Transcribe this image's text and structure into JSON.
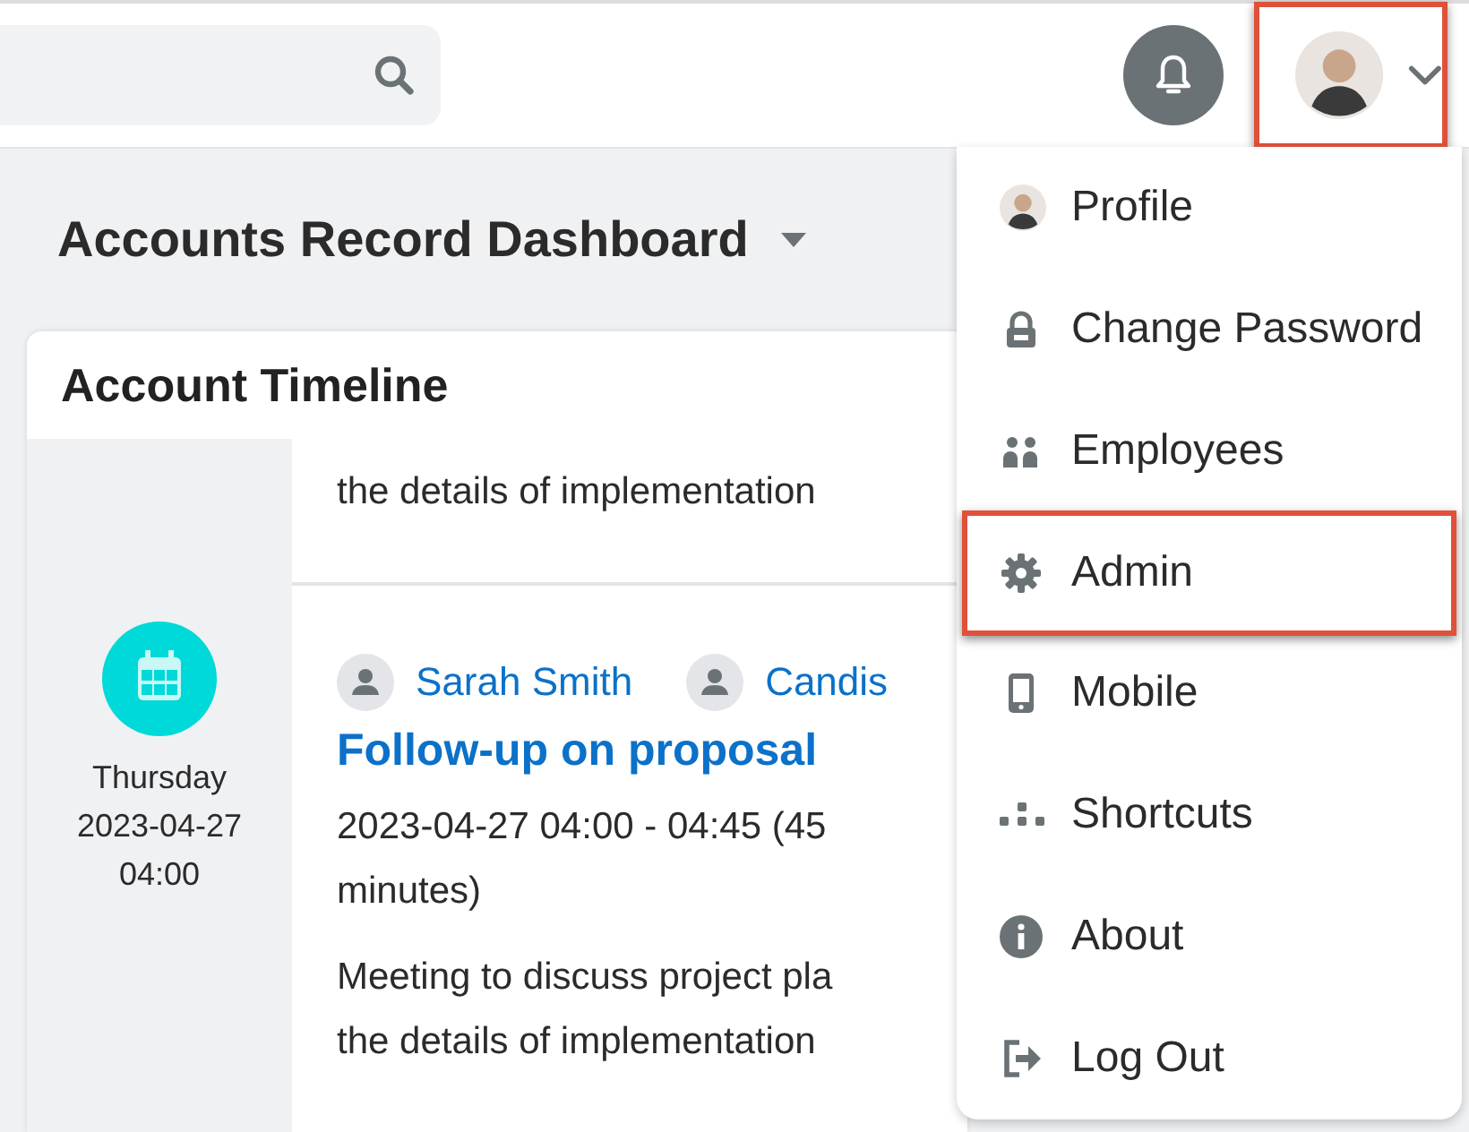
{
  "header": {
    "user_button": {
      "highlighted": true
    }
  },
  "dashboard": {
    "title": "Accounts Record Dashboard"
  },
  "timeline": {
    "title": "Account Timeline",
    "entries": [
      {
        "description": [
          "the details of implementation"
        ]
      },
      {
        "day": "Thursday",
        "date": "2023-04-27",
        "time": "04:00",
        "people": [
          "Sarah Smith",
          "Candis"
        ],
        "title": "Follow-up on proposal",
        "period": [
          "2023-04-27 04:00 - 04:45 (45",
          "minutes)"
        ],
        "description": [
          "Meeting to discuss project pla",
          "the details of implementation"
        ]
      }
    ]
  },
  "user_menu": {
    "items": [
      {
        "label": "Profile",
        "highlighted": false
      },
      {
        "label": "Change Password",
        "highlighted": false
      },
      {
        "label": "Employees",
        "highlighted": false
      },
      {
        "label": "Admin",
        "highlighted": true
      },
      {
        "label": "Mobile",
        "highlighted": false
      },
      {
        "label": "Shortcuts",
        "highlighted": false
      },
      {
        "label": "About",
        "highlighted": false
      },
      {
        "label": "Log Out",
        "highlighted": false
      }
    ]
  }
}
